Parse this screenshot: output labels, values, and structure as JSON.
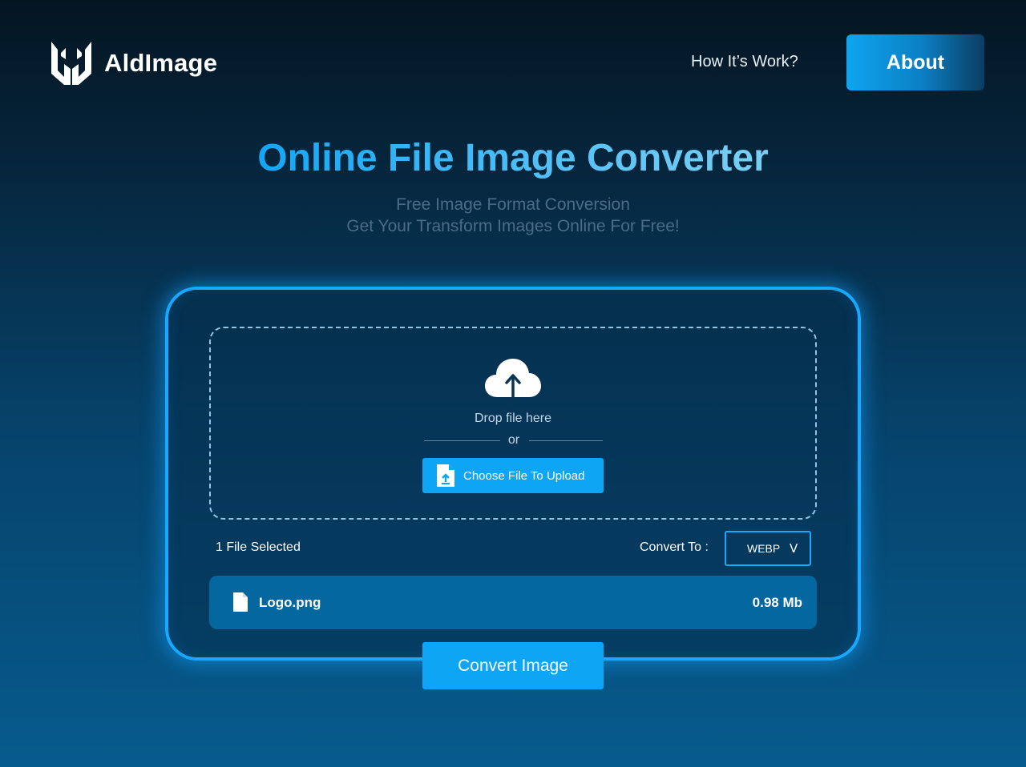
{
  "header": {
    "brand_name": "AldImage",
    "logo_icon": "aldimage-logo-icon",
    "nav_link": "How It’s Work?",
    "about_label": "About"
  },
  "hero": {
    "title": "Online File Image Converter",
    "subtitle_line1": "Free Image Format Conversion",
    "subtitle_line2": "Get Your Transform Images Online For Free!"
  },
  "uploader": {
    "icon": "cloud-upload-icon",
    "drop_text": "Drop file here",
    "or_text": "or",
    "choose_label": "Choose File To Upload",
    "choose_icon": "file-upload-icon"
  },
  "selection": {
    "count_label": "1 File Selected",
    "convert_to_label": "Convert To :",
    "format_value": "WEBP",
    "format_chevron": "V"
  },
  "files": [
    {
      "name": "Logo.png",
      "size": "0.98 Mb",
      "icon": "file-icon"
    }
  ],
  "actions": {
    "convert_label": "Convert Image"
  },
  "colors": {
    "accent": "#0EA5F5",
    "card_border": "#17A9FF",
    "file_row": "#05679F",
    "title_gradient_start": "#12A6F6",
    "title_gradient_end": "#79CFF3"
  }
}
